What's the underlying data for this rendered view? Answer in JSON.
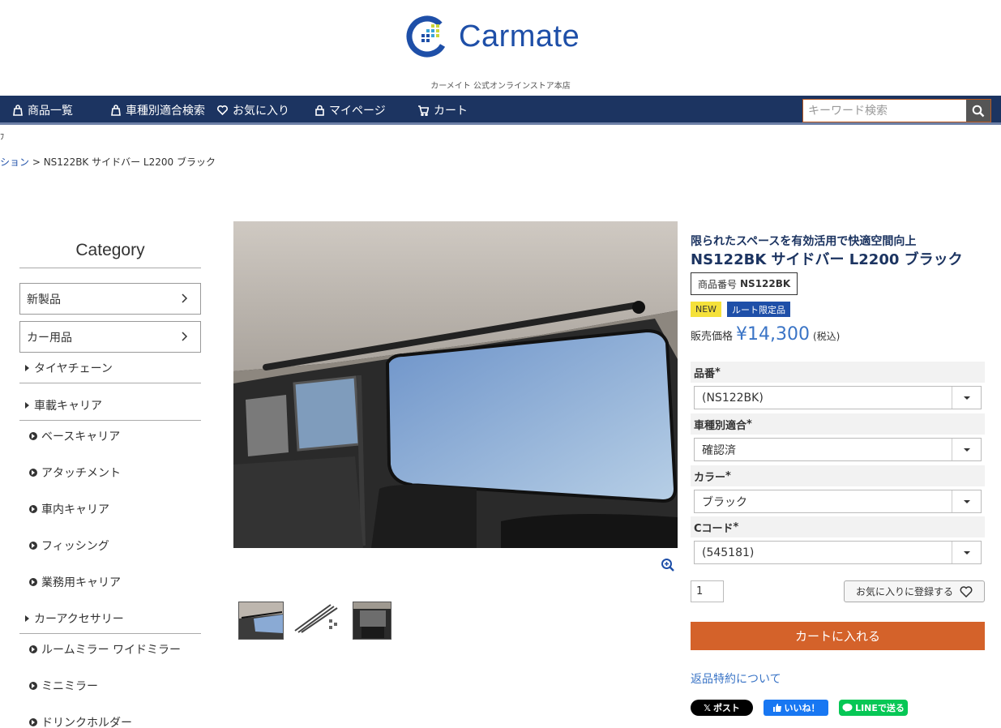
{
  "brand": {
    "name": "Carmate",
    "tagline": "カーメイト 公式オンラインストア本店"
  },
  "nav": {
    "items": [
      {
        "label": "商品一覧",
        "icon": "bag-icon"
      },
      {
        "label": "車種別適合検索",
        "icon": "bag-icon"
      },
      {
        "label": "お気に入り",
        "icon": "heart-icon"
      },
      {
        "label": "マイページ",
        "icon": "lock-icon"
      },
      {
        "label": "カート",
        "icon": "cart-icon"
      }
    ],
    "search_placeholder": "キーワード検索"
  },
  "crumb_cut": "ﾌ",
  "breadcrumb": {
    "parent": "ション",
    "sep": " > ",
    "current": "NS122BK サイドバー L2200 ブラック"
  },
  "sidebar": {
    "title": "Category",
    "boxes": [
      "新製品",
      "カー用品"
    ],
    "groups": [
      {
        "label": "タイヤチェーン"
      },
      {
        "label": "車載キャリア"
      },
      {
        "label": "カーアクセサリー"
      }
    ],
    "carrier_items": [
      "ベースキャリア",
      "アタッチメント",
      "車内キャリア",
      "フィッシング",
      "業務用キャリア"
    ],
    "accessory_items": [
      "ルームミラー ワイドミラー",
      "ミニミラー",
      "ドリンクホルダー"
    ]
  },
  "product": {
    "catch": "限られたスペースを有効活用で快適空間向上",
    "name": "NS122BK サイドバー L2200 ブラック",
    "code_label": "商品番号",
    "code": "NS122BK",
    "badges": [
      "NEW",
      "ルート限定品"
    ],
    "price_label": "販売価格",
    "price": "¥14,300",
    "tax": "(税込)",
    "options": [
      {
        "label": "品番",
        "value": "(NS122BK)"
      },
      {
        "label": "車種別適合",
        "value": "確認済"
      },
      {
        "label": "カラー",
        "value": "ブラック"
      },
      {
        "label": "Cコード",
        "value": "(545181)"
      }
    ],
    "required_mark": "*",
    "quantity": "1",
    "favorite_label": "お気に入りに登録する",
    "cart_label": "カートに入れる",
    "return_link": "返品特約について"
  },
  "share": {
    "x": "ポスト",
    "fb": "いいね！",
    "line": "LINEで送る"
  },
  "colors": {
    "nav_bg": "#1c3461",
    "brand_blue": "#1e4fa8",
    "cart_orange": "#d4622a",
    "price_blue": "#3a74c6"
  }
}
